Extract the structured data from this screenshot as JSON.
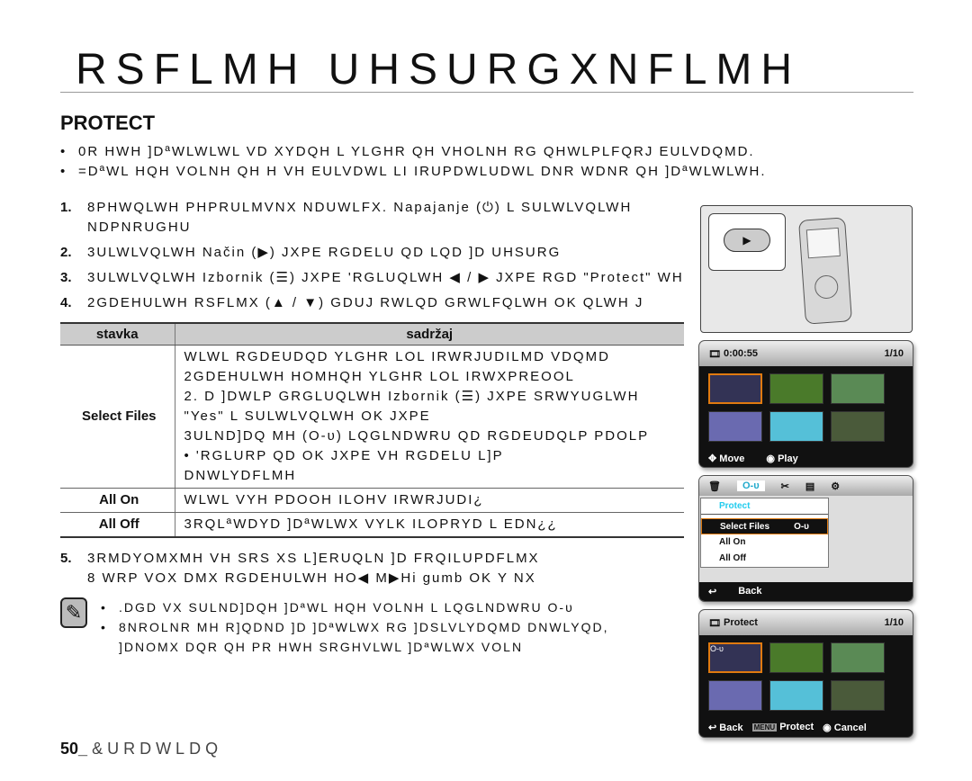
{
  "title": "RSFLMH UHSURGXNFLMH",
  "section": "PROTECT",
  "bullets": [
    "0R HWH ]DªWLWLWL VD XYDQH L YLGHR QH VHOLNH RG QHWLPLFQRJ EULVDQMD.",
    "=DªWL HQH VOLNH QH H VH EULVDWL LI IRUPDWLUDWL DNR WDNR QH ]DªWLWLWH."
  ],
  "steps": [
    {
      "n": "1.",
      "text": "8PHWQLWH PHPRULMVNX NDUWLFX.  Napajanje (⏻) L SULWLVQLWH",
      "cont": "NDPNRUGHU"
    },
    {
      "n": "2.",
      "text": "3ULWLVQLWH Način (▶) JXPE RGDELU QD LQD ]D UHSURG"
    },
    {
      "n": "3.",
      "text": "3ULWLVQLWH Izbornik (☰) JXPE 'RGLUQLWH ◀ / ▶ JXPE RGD \"Protect\" WH"
    },
    {
      "n": "4.",
      "text": "2GDEHULWH RSFLMX (▲ / ▼) GDUJ RWLQD GRWLFQLWH OK QLWH J"
    }
  ],
  "table": {
    "headers": [
      "stavka",
      "sadržaj"
    ],
    "rows": [
      {
        "item": "Select Files",
        "lines": [
          "WLWL RGDEUDQD YLGHR LOL IRWRJUDILMD VDQMD",
          "2GDEHULWH HOMHQH YLGHR LOL IRWXPREOOL",
          "2. D ]DWLP GRGLUQLWH Izbornik (☰) JXPE SRWYUGLWH",
          "\"Yes\" L SULWLVQLWH OK JXPE",
          "3ULND]DQ MH (O-ᴜ) LQGLNDWRU QD RGDEUDQLP PDOLP",
          "• 'RGLURP QD OK JXPE VH RGDELU L]P",
          "  DNWLYDFLMH"
        ]
      },
      {
        "item": "All On",
        "lines": [
          "WLWL VYH PDOOH ILOHV IRWRJUDI¿"
        ]
      },
      {
        "item": "All Off",
        "lines": [
          "3RQLªWDYD ]DªWLWX VYLK ILOPRYD L EDN¿¿"
        ]
      }
    ]
  },
  "step5": {
    "n": "5.",
    "line1": "3RMDYOMXMH VH SRS XS L]ERUQLN ]D FRQILUPDFLMX",
    "line2": "8 WRP VOX DMX  RGDEHULWH  HO◀ M▶Hi gumb OK Y NX"
  },
  "notes": [
    ".DGD VX SULND]DQH ]DªWL HQH VOLNH L LQGLNDWRU O-ᴜ",
    "8NROLNR MH R]QDND ]D ]DªWLWX RG ]DSLVLYDQMD DNWLYQD,",
    " ]DNOMX DQR  QH PR HWH SRGHVLWL ]DªWLWX VOLN"
  ],
  "footer": {
    "page": "50_",
    "label": "&URDWLDQ"
  },
  "screen1": {
    "time": "0:00:55",
    "count": "1/10",
    "move": "Move",
    "play": "Play"
  },
  "screen2": {
    "menu_title": "Protect",
    "items": [
      "Select Files",
      "All On",
      "All Off"
    ],
    "back": "Back"
  },
  "screen3": {
    "title": "Protect",
    "count": "1/10",
    "back": "Back",
    "menu_key": "MENU",
    "protect": "Protect",
    "cancel": "Cancel"
  },
  "colors": {
    "highlight": "#e07a10",
    "menu_title": "#22ccee"
  }
}
